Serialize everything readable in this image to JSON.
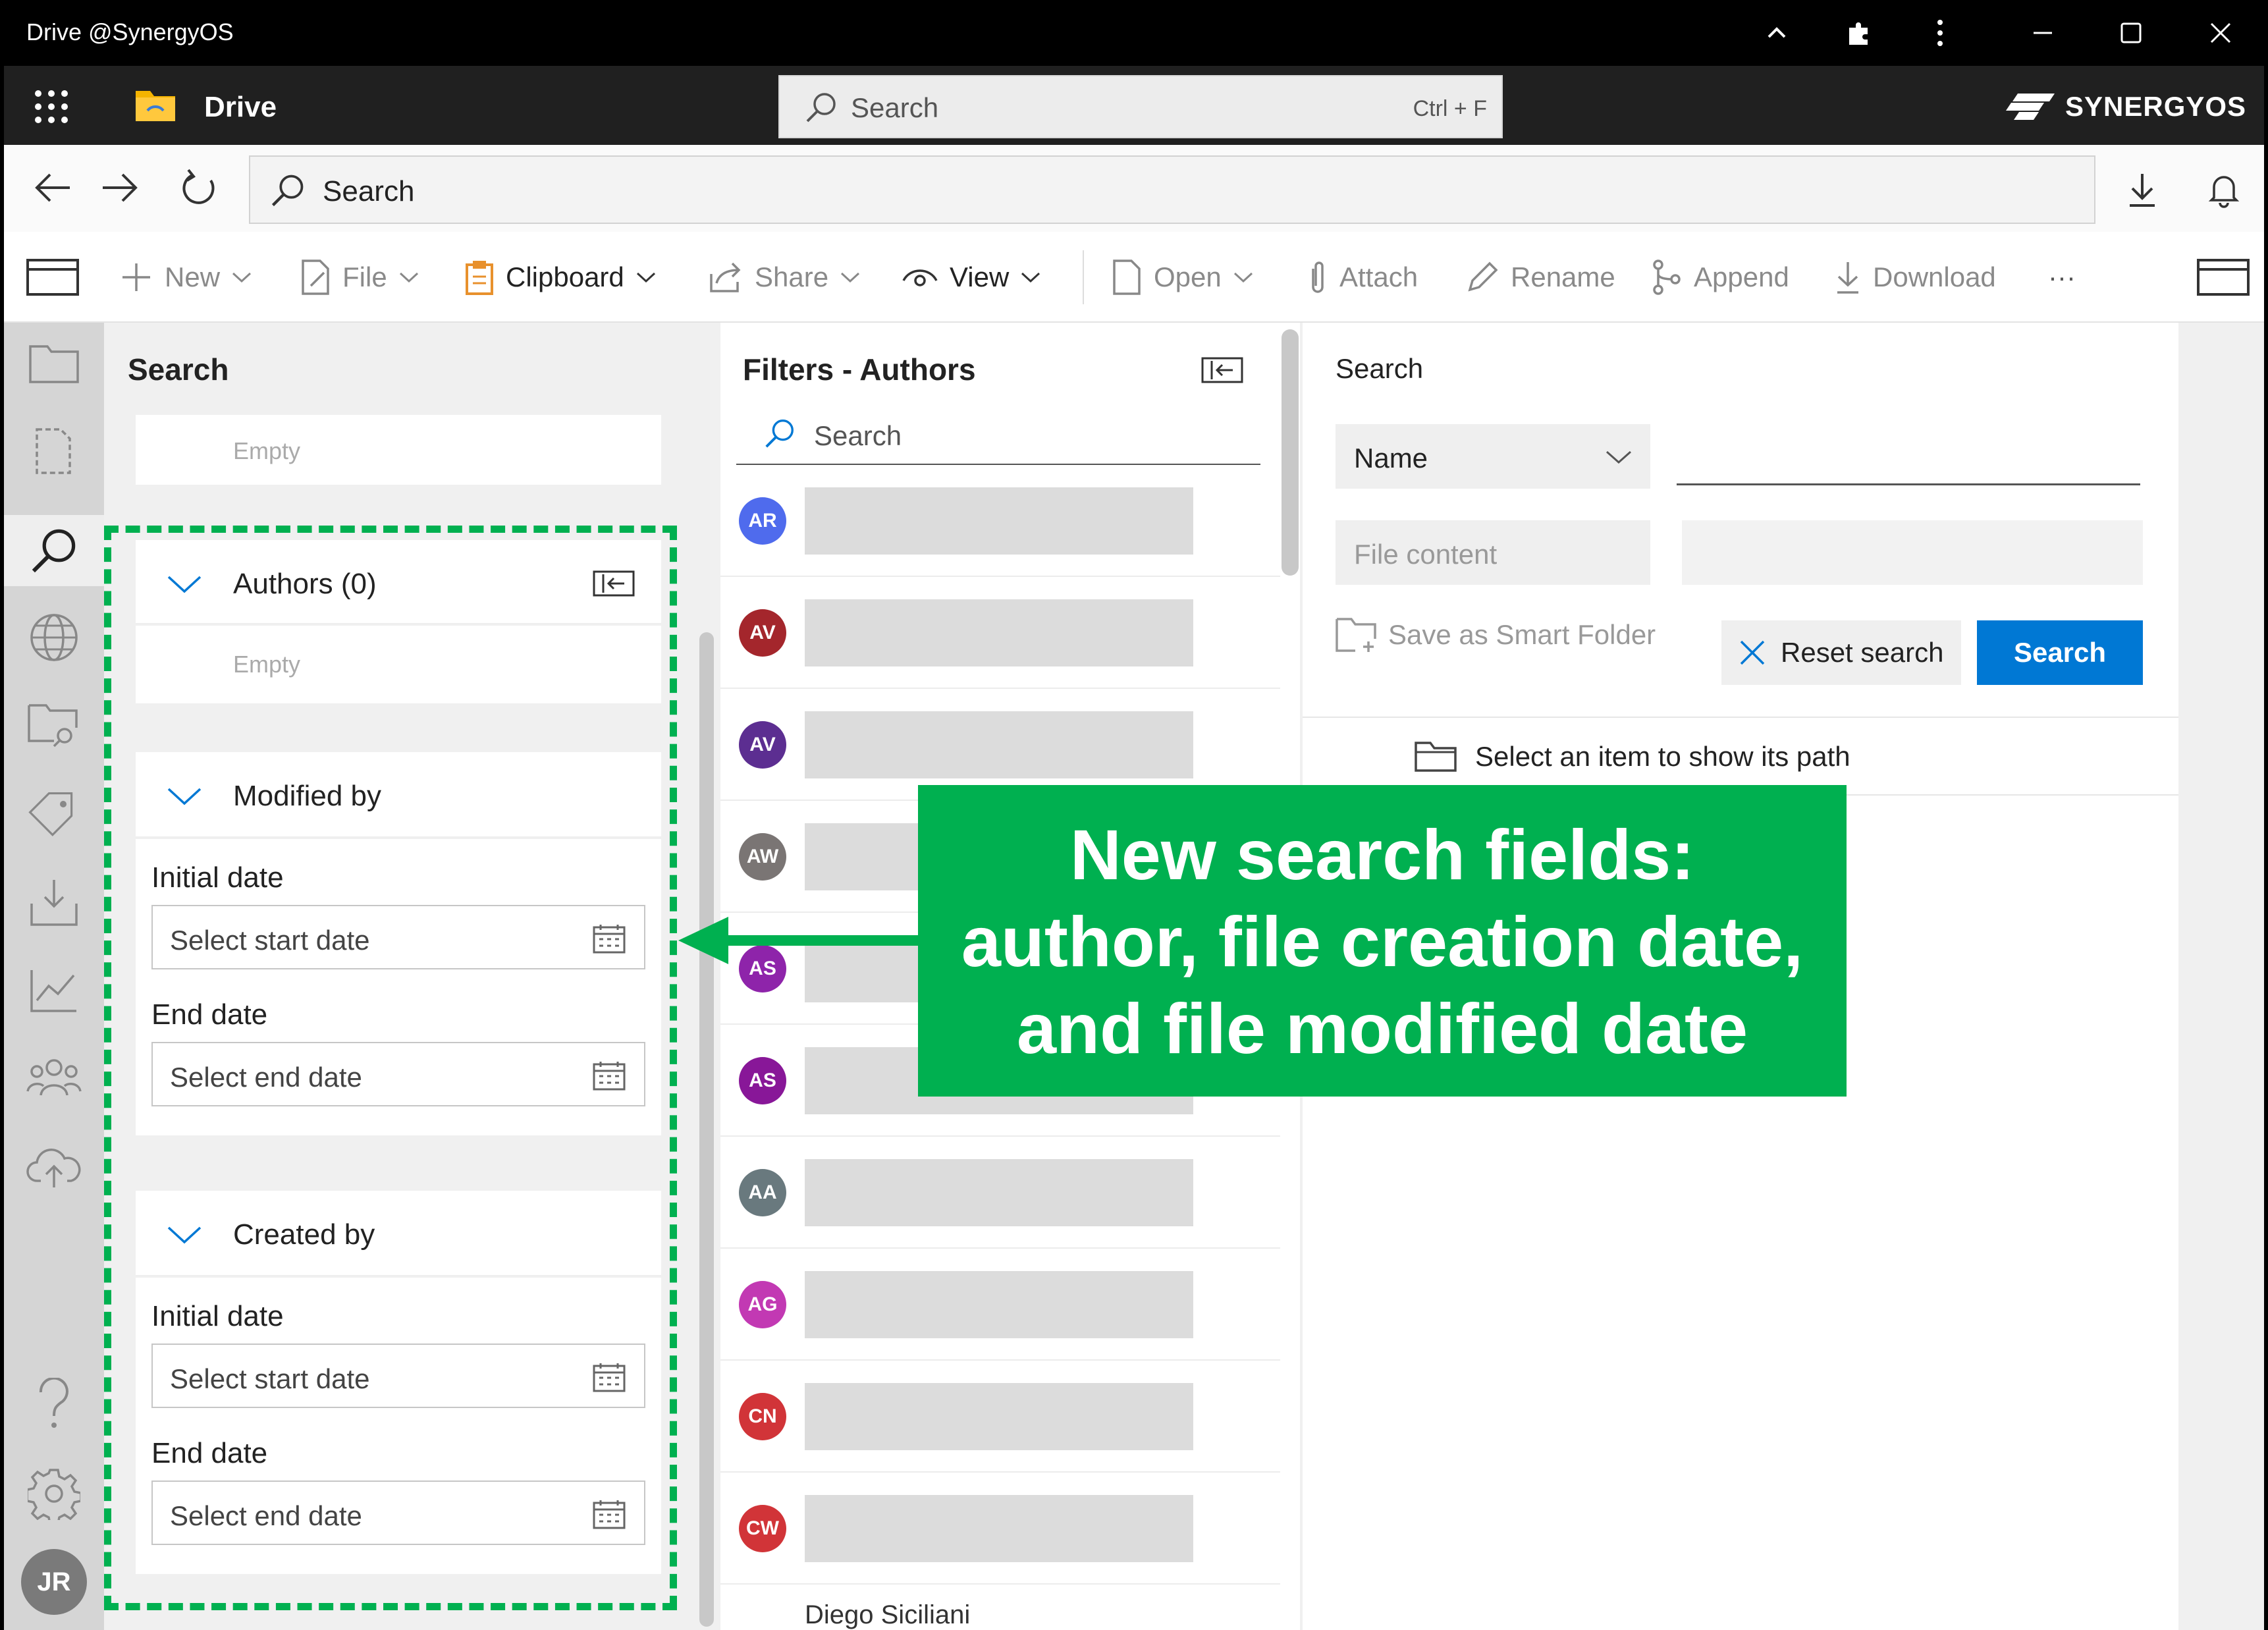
{
  "window": {
    "title": "Drive @SynergyOS"
  },
  "header": {
    "app_name": "Drive",
    "search_placeholder": "Search",
    "search_shortcut": "Ctrl + F",
    "brand": "SYNERGYOS"
  },
  "nav": {
    "search_placeholder": "Search"
  },
  "toolbar": {
    "new": "New",
    "file": "File",
    "clipboard": "Clipboard",
    "share": "Share",
    "view": "View",
    "open": "Open",
    "attach": "Attach",
    "rename": "Rename",
    "append": "Append",
    "download": "Download",
    "more": "···"
  },
  "search_panel": {
    "title": "Search",
    "empty_top": "Empty",
    "authors_label": "Authors (0)",
    "authors_empty": "Empty",
    "modified_label": "Modified by",
    "created_label": "Created by",
    "initial_date": "Initial date",
    "end_date": "End date",
    "start_placeholder": "Select start date",
    "end_placeholder": "Select end date"
  },
  "filters": {
    "title": "Filters - Authors",
    "search_placeholder": "Search",
    "authors": [
      {
        "initials": "AR",
        "color": "#4f6bed"
      },
      {
        "initials": "AV",
        "color": "#a4262c"
      },
      {
        "initials": "AV",
        "color": "#5c2e91"
      },
      {
        "initials": "AW",
        "color": "#7a7574"
      },
      {
        "initials": "AS",
        "color": "#8e24aa"
      },
      {
        "initials": "AS",
        "color": "#881798"
      },
      {
        "initials": "AA",
        "color": "#69797e"
      },
      {
        "initials": "AG",
        "color": "#c239b3"
      },
      {
        "initials": "CN",
        "color": "#d13438"
      },
      {
        "initials": "CW",
        "color": "#d13438"
      }
    ],
    "partial_name": "Diego Siciliani"
  },
  "right": {
    "title": "Search",
    "field_select": "Name",
    "file_content": "File content",
    "save_smart": "Save as Smart Folder",
    "reset": "Reset search",
    "search_btn": "Search",
    "path_hint": "Select an item to show its path"
  },
  "user": {
    "initials": "JR"
  },
  "callout": {
    "line1": "New search fields:",
    "line2": "author, file creation date,",
    "line3": "and file modified date"
  },
  "colors": {
    "accent": "#0078d4",
    "callout": "#00b050"
  }
}
